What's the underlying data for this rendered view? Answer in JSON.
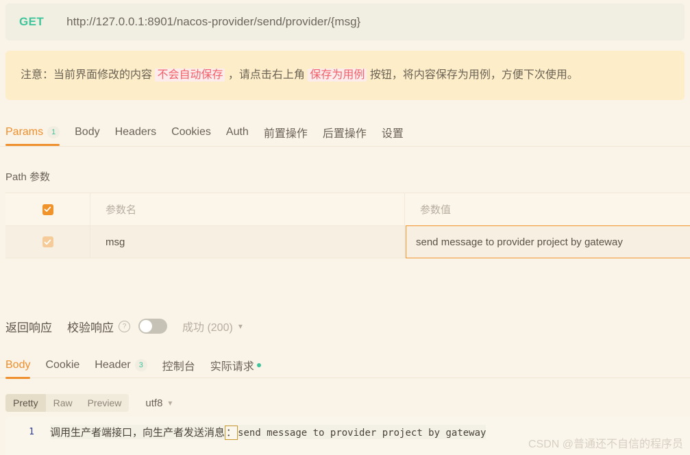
{
  "request": {
    "method": "GET",
    "url": "http://127.0.0.1:8901/nacos-provider/send/provider/{msg}"
  },
  "notice": {
    "prefix": "注意：当前界面修改的内容 ",
    "highlight1": "不会自动保存",
    "middle": " ，请点击右上角 ",
    "highlight2": "保存为用例",
    "suffix": " 按钮，将内容保存为用例，方便下次使用。"
  },
  "request_tabs": [
    {
      "label": "Params",
      "badge": "1",
      "active": true
    },
    {
      "label": "Body",
      "badge": "",
      "active": false
    },
    {
      "label": "Headers",
      "badge": "",
      "active": false
    },
    {
      "label": "Cookies",
      "badge": "",
      "active": false
    },
    {
      "label": "Auth",
      "badge": "",
      "active": false
    },
    {
      "label": "前置操作",
      "badge": "",
      "active": false
    },
    {
      "label": "后置操作",
      "badge": "",
      "active": false
    },
    {
      "label": "设置",
      "badge": "",
      "active": false
    }
  ],
  "params": {
    "section_title": "Path 参数",
    "header": {
      "name_placeholder": "参数名",
      "value_placeholder": "参数值",
      "checked": true
    },
    "rows": [
      {
        "checked": true,
        "name": "msg",
        "value": "send message to provider project by gateway"
      }
    ]
  },
  "response": {
    "title": "返回响应",
    "verify_label": "校验响应",
    "help_icon": "?",
    "toggle_on": false,
    "status": "成功 (200)",
    "tabs": [
      {
        "label": "Body",
        "badge": "",
        "dot": false,
        "active": true
      },
      {
        "label": "Cookie",
        "badge": "",
        "dot": false,
        "active": false
      },
      {
        "label": "Header",
        "badge": "3",
        "dot": false,
        "active": false
      },
      {
        "label": "控制台",
        "badge": "",
        "dot": false,
        "active": false
      },
      {
        "label": "实际请求",
        "badge": "",
        "dot": true,
        "active": false
      }
    ],
    "view_modes": [
      {
        "label": "Pretty",
        "selected": true
      },
      {
        "label": "Raw",
        "selected": false
      },
      {
        "label": "Preview",
        "selected": false
      }
    ],
    "encoding": "utf8",
    "body": {
      "line_number": "1",
      "text_cn": "调用生产者端接口，向生产者发送消息",
      "colon": "：",
      "text_en": "send message to provider project by gateway"
    }
  },
  "watermark": "CSDN @普通还不自信的程序员"
}
